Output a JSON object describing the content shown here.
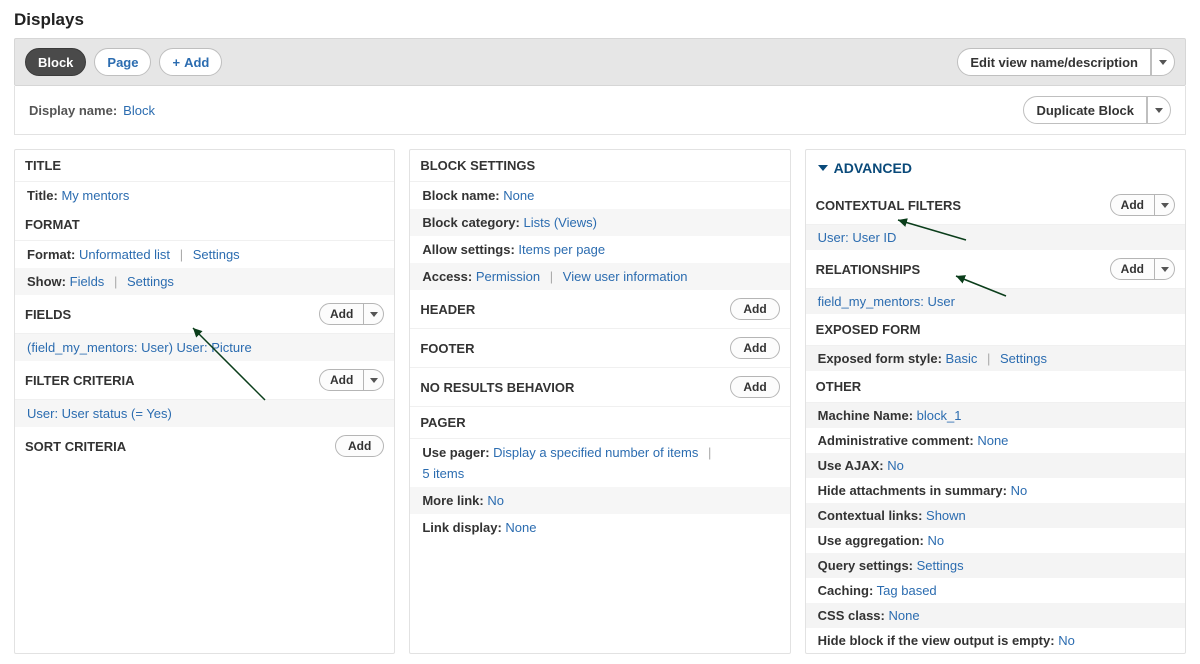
{
  "page_title": "Displays",
  "tabs": {
    "block": "Block",
    "page": "Page"
  },
  "add_btn": "Add",
  "edit_view_btn": "Edit view name/description",
  "display_name": {
    "label": "Display name:",
    "value": "Block"
  },
  "duplicate_btn": "Duplicate Block",
  "col1": {
    "title_h": "TITLE",
    "title_label": "Title:",
    "title_value": "My mentors",
    "format_h": "FORMAT",
    "format_label": "Format:",
    "format_value": "Unformatted list",
    "format_settings": "Settings",
    "show_label": "Show:",
    "show_value": "Fields",
    "show_settings": "Settings",
    "fields_h": "FIELDS",
    "fields_add": "Add",
    "field_row": "(field_my_mentors: User) User: Picture",
    "filter_h": "FILTER CRITERIA",
    "filter_add": "Add",
    "filter_row": "User: User status (= Yes)",
    "sort_h": "SORT CRITERIA",
    "sort_add": "Add"
  },
  "col2": {
    "block_h": "BLOCK SETTINGS",
    "bname_l": "Block name:",
    "bname_v": "None",
    "bcat_l": "Block category:",
    "bcat_v": "Lists (Views)",
    "allow_l": "Allow settings:",
    "allow_v": "Items per page",
    "access_l": "Access:",
    "access_v": "Permission",
    "access_link": "View user information",
    "header_h": "HEADER",
    "header_add": "Add",
    "footer_h": "FOOTER",
    "footer_add": "Add",
    "nores_h": "NO RESULTS BEHAVIOR",
    "nores_add": "Add",
    "pager_h": "PAGER",
    "pager_l": "Use pager:",
    "pager_v": "Display a specified number of items",
    "pager_items": "5 items",
    "more_l": "More link:",
    "more_v": "No",
    "linkdisp_l": "Link display:",
    "linkdisp_v": "None"
  },
  "col3": {
    "adv": "ADVANCED",
    "ctx_h": "CONTEXTUAL FILTERS",
    "ctx_add": "Add",
    "ctx_row": "User: User ID",
    "rel_h": "RELATIONSHIPS",
    "rel_add": "Add",
    "rel_row": "field_my_mentors: User",
    "exp_h": "EXPOSED FORM",
    "exp_l": "Exposed form style:",
    "exp_v": "Basic",
    "exp_set": "Settings",
    "other_h": "OTHER",
    "mname_l": "Machine Name:",
    "mname_v": "block_1",
    "admin_l": "Administrative comment:",
    "admin_v": "None",
    "ajax_l": "Use AJAX:",
    "ajax_v": "No",
    "hide_l": "Hide attachments in summary:",
    "hide_v": "No",
    "ctxl_l": "Contextual links:",
    "ctxl_v": "Shown",
    "agg_l": "Use aggregation:",
    "agg_v": "No",
    "qset_l": "Query settings:",
    "qset_v": "Settings",
    "cache_l": "Caching:",
    "cache_v": "Tag based",
    "css_l": "CSS class:",
    "css_v": "None",
    "hideblock_l": "Hide block if the view output is empty:",
    "hideblock_v": "No"
  }
}
